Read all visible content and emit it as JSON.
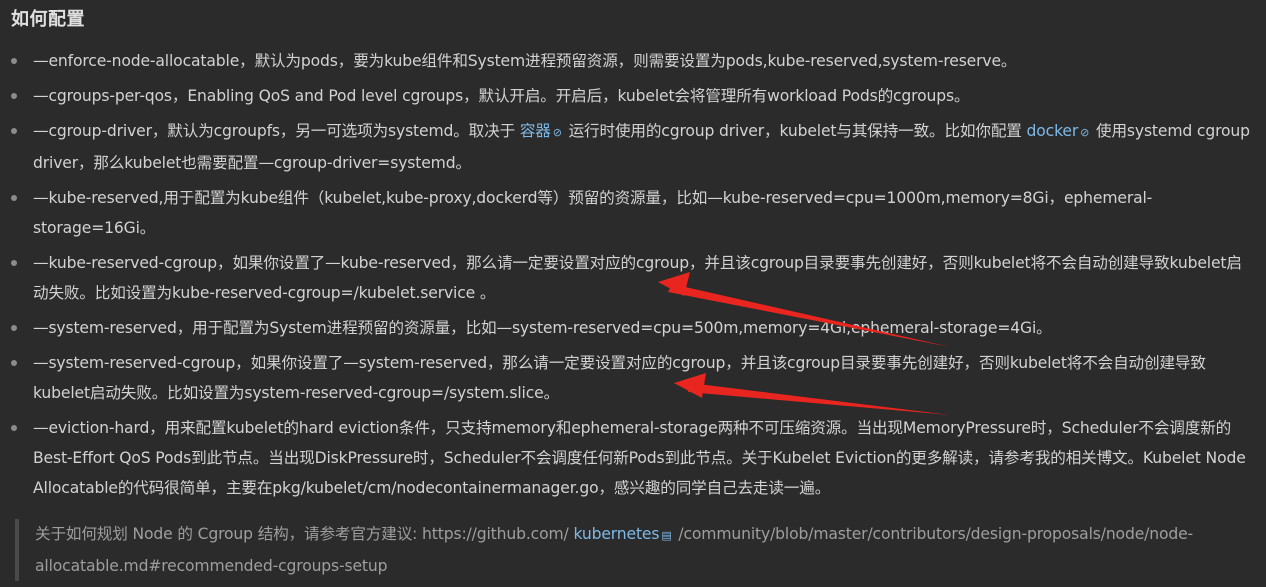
{
  "heading": "如何配置",
  "items": [
    {
      "text": "—enforce-node-allocatable，默认为pods，要为kube组件和System进程预留资源，则需要设置为pods,kube-reserved,system-reserve。"
    },
    {
      "text": "—cgroups-per-qos，Enabling QoS and Pod level cgroups，默认开启。开启后，kubelet会将管理所有workload Pods的cgroups。"
    },
    {
      "part1": "—cgroup-driver，默认为cgroupfs，另一可选项为systemd。取决于",
      "link1": "容器",
      "part2": "运行时使用的cgroup driver，kubelet与其保持一致。比如你配置",
      "link2": "docker",
      "part3": "使用systemd cgroup driver，那么kubelet也需要配置—cgroup-driver=systemd。"
    },
    {
      "text": "—kube-reserved,用于配置为kube组件（kubelet,kube-proxy,dockerd等）预留的资源量，比如—kube-reserved=cpu=1000m,memory=8Gi，ephemeral-storage=16Gi。"
    },
    {
      "text": "—kube-reserved-cgroup，如果你设置了—kube-reserved，那么请一定要设置对应的cgroup，并且该cgroup目录要事先创建好，否则kubelet将不会自动创建导致kubelet启动失败。比如设置为kube-reserved-cgroup=/kubelet.service 。"
    },
    {
      "text": "—system-reserved，用于配置为System进程预留的资源量，比如—system-reserved=cpu=500m,memory=4Gi,ephemeral-storage=4Gi。"
    },
    {
      "text": "—system-reserved-cgroup，如果你设置了—system-reserved，那么请一定要设置对应的cgroup，并且该cgroup目录要事先创建好，否则kubelet将不会自动创建导致kubelet启动失败。比如设置为system-reserved-cgroup=/system.slice。"
    },
    {
      "text": "—eviction-hard，用来配置kubelet的hard eviction条件，只支持memory和ephemeral-storage两种不可压缩资源。当出现MemoryPressure时，Scheduler不会调度新的Best-Effort QoS Pods到此节点。当出现DiskPressure时，Scheduler不会调度任何新Pods到此节点。关于Kubelet Eviction的更多解读，请参考我的相关博文。Kubelet Node Allocatable的代码很简单，主要在pkg/kubelet/cm/nodecontainermanager.go，感兴趣的同学自己去走读一遍。"
    }
  ],
  "quote": {
    "part1": "关于如何规划 Node 的 Cgroup 结构，请参考官方建议: https://github.com/",
    "link": "kubernetes",
    "part2": "/community/blob/master/contributors/design-proposals/node/node-allocatable.md#recommended-cgroups-setup"
  },
  "colors": {
    "background": "#2b2b2b",
    "text": "#d2d2d2",
    "link": "#7db9e8",
    "arrow": "#e8251f"
  },
  "icons": {
    "external_link": "link-icon",
    "book": "book-icon",
    "arrow": "red-arrow-annotation"
  }
}
